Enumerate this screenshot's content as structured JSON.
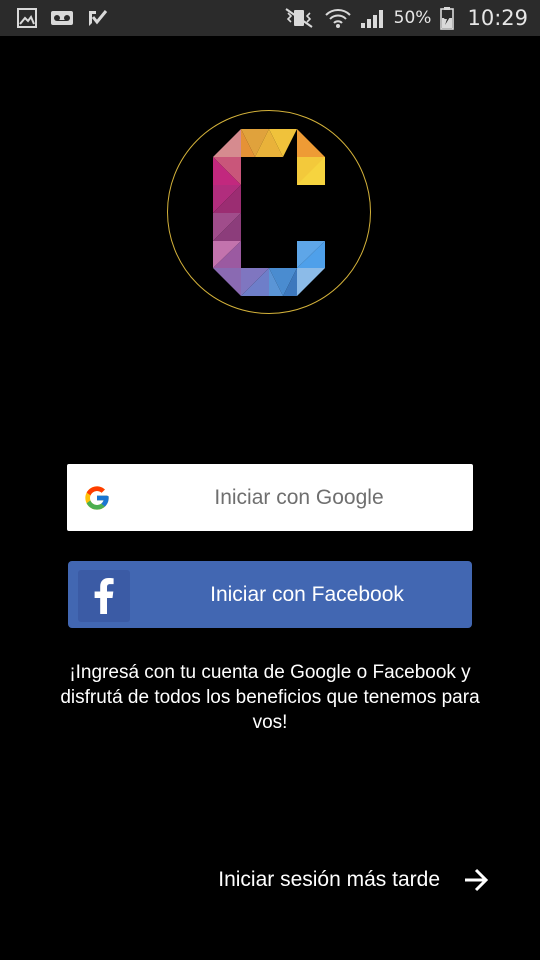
{
  "status_bar": {
    "left_icons": [
      "image-icon",
      "voicemail-icon",
      "checkbox-icon"
    ],
    "right_icons": [
      "vibrate-icon",
      "wifi-icon",
      "signal-icon",
      "battery-icon"
    ],
    "battery_percent": "50%",
    "time": "10:29"
  },
  "logo": {
    "name": "c-logo-icon",
    "ring_color": "#d4b23a"
  },
  "login": {
    "google_label": "Iniciar con Google",
    "facebook_label": "Iniciar con Facebook",
    "info_line_1": "¡Ingresá con tu cuenta de Google o Facebook y",
    "info_line_2": "disfrutá de todos los beneficios que tenemos para",
    "info_line_3": "vos!",
    "later_label": "Iniciar sesión más tarde"
  },
  "colors": {
    "background": "#000000",
    "status_bar": "#2b2b2b",
    "facebook_blue": "#4267b2",
    "google_button": "#ffffff"
  }
}
